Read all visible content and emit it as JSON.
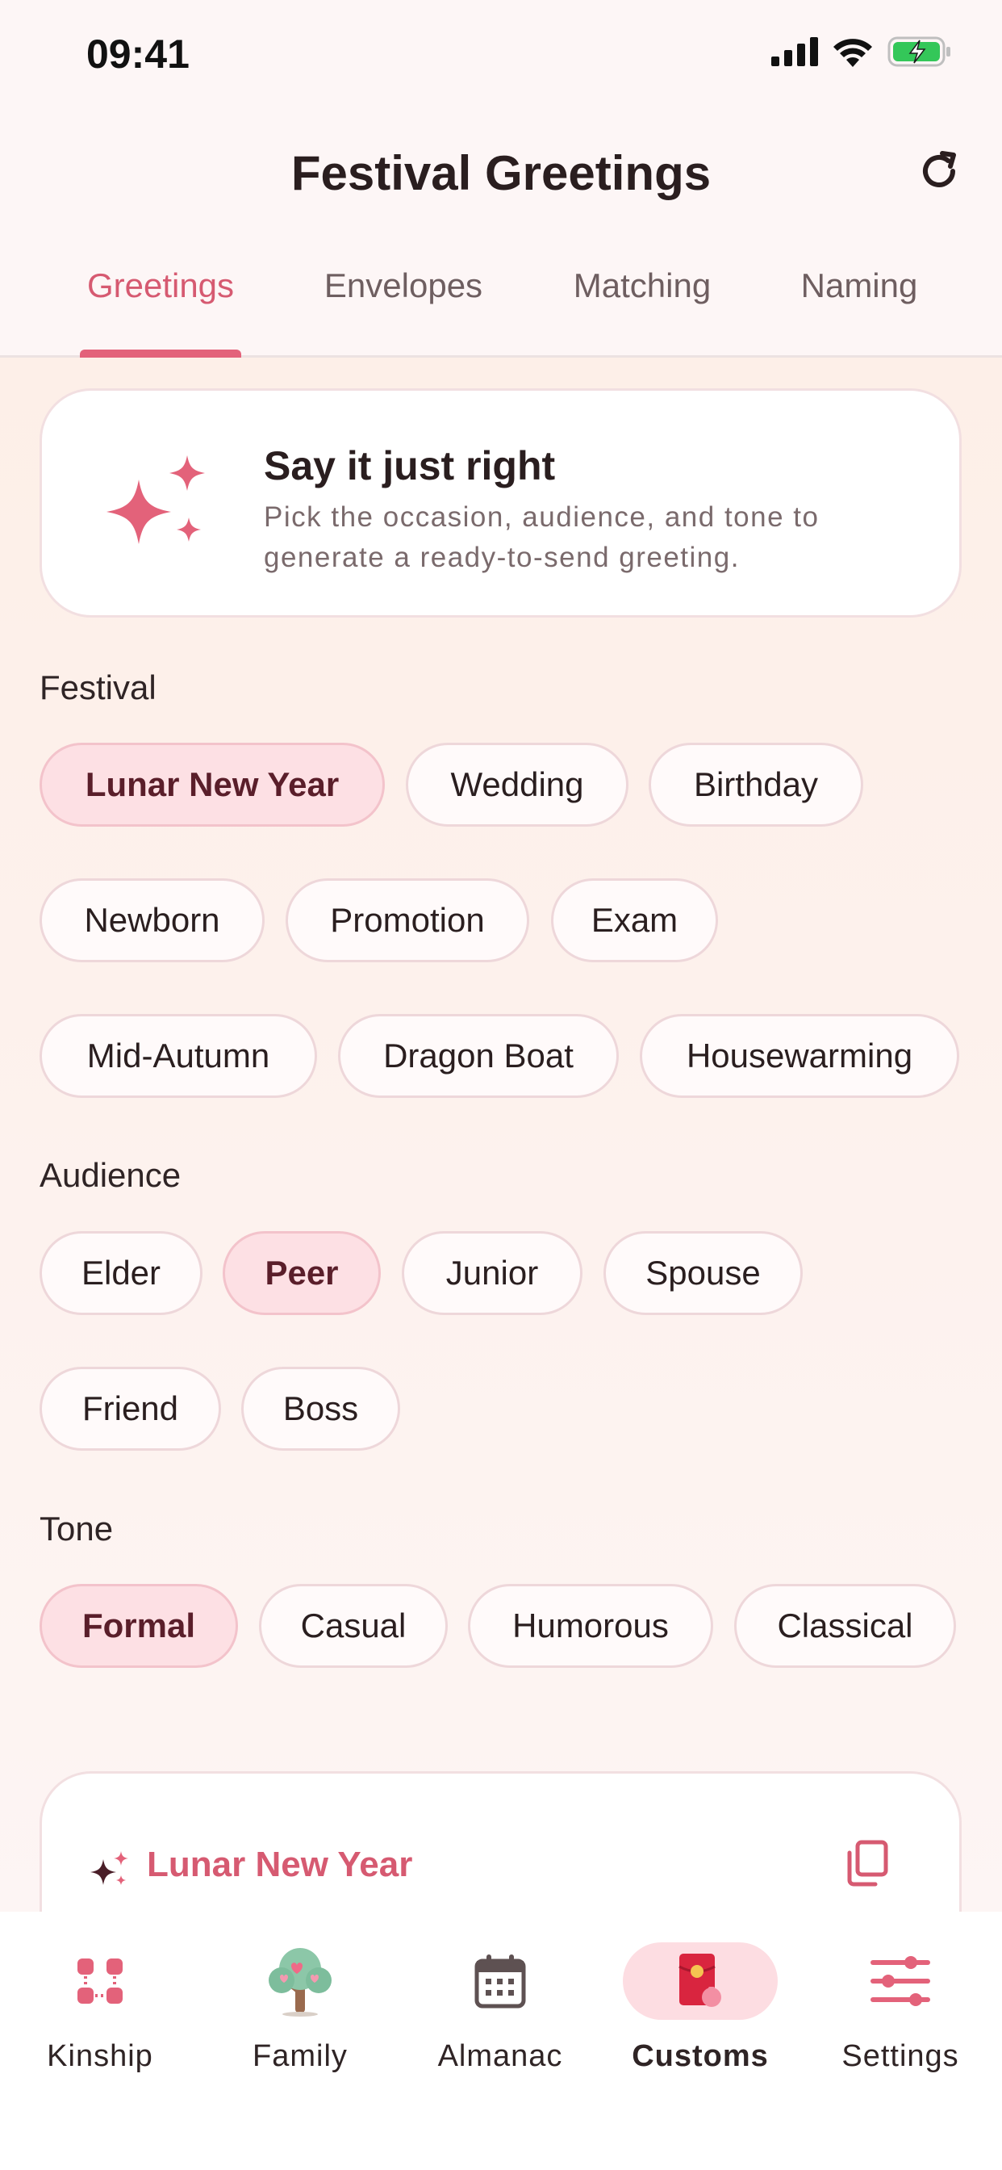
{
  "status_bar": {
    "time": "09:41"
  },
  "header": {
    "title": "Festival Greetings"
  },
  "tabs": [
    {
      "label": "Greetings",
      "active": true
    },
    {
      "label": "Envelopes",
      "active": false
    },
    {
      "label": "Matching",
      "active": false
    },
    {
      "label": "Naming",
      "active": false
    }
  ],
  "hero": {
    "title": "Say it just right",
    "description": "Pick the occasion, audience, and tone to generate a ready-to-send greeting."
  },
  "festival": {
    "label": "Festival",
    "options": [
      "Lunar New Year",
      "Wedding",
      "Birthday",
      "Newborn",
      "Promotion",
      "Exam",
      "Mid-Autumn",
      "Dragon Boat",
      "Housewarming"
    ],
    "selected": "Lunar New Year"
  },
  "audience": {
    "label": "Audience",
    "options": [
      "Elder",
      "Peer",
      "Junior",
      "Spouse",
      "Friend",
      "Boss"
    ],
    "selected": "Peer"
  },
  "tone": {
    "label": "Tone",
    "options": [
      "Formal",
      "Casual",
      "Humorous",
      "Classical"
    ],
    "selected": "Formal"
  },
  "result": {
    "title": "Lunar New Year"
  },
  "bottom_nav": [
    {
      "label": "Kinship",
      "icon": "kinship-icon",
      "active": false
    },
    {
      "label": "Family",
      "icon": "family-tree-icon",
      "active": false
    },
    {
      "label": "Almanac",
      "icon": "calendar-icon",
      "active": false
    },
    {
      "label": "Customs",
      "icon": "red-envelope-icon",
      "active": true
    },
    {
      "label": "Settings",
      "icon": "sliders-icon",
      "active": false
    }
  ],
  "colors": {
    "accent": "#e3627a",
    "chip_selected": "#fde0e4",
    "background": "#fdeee5"
  }
}
